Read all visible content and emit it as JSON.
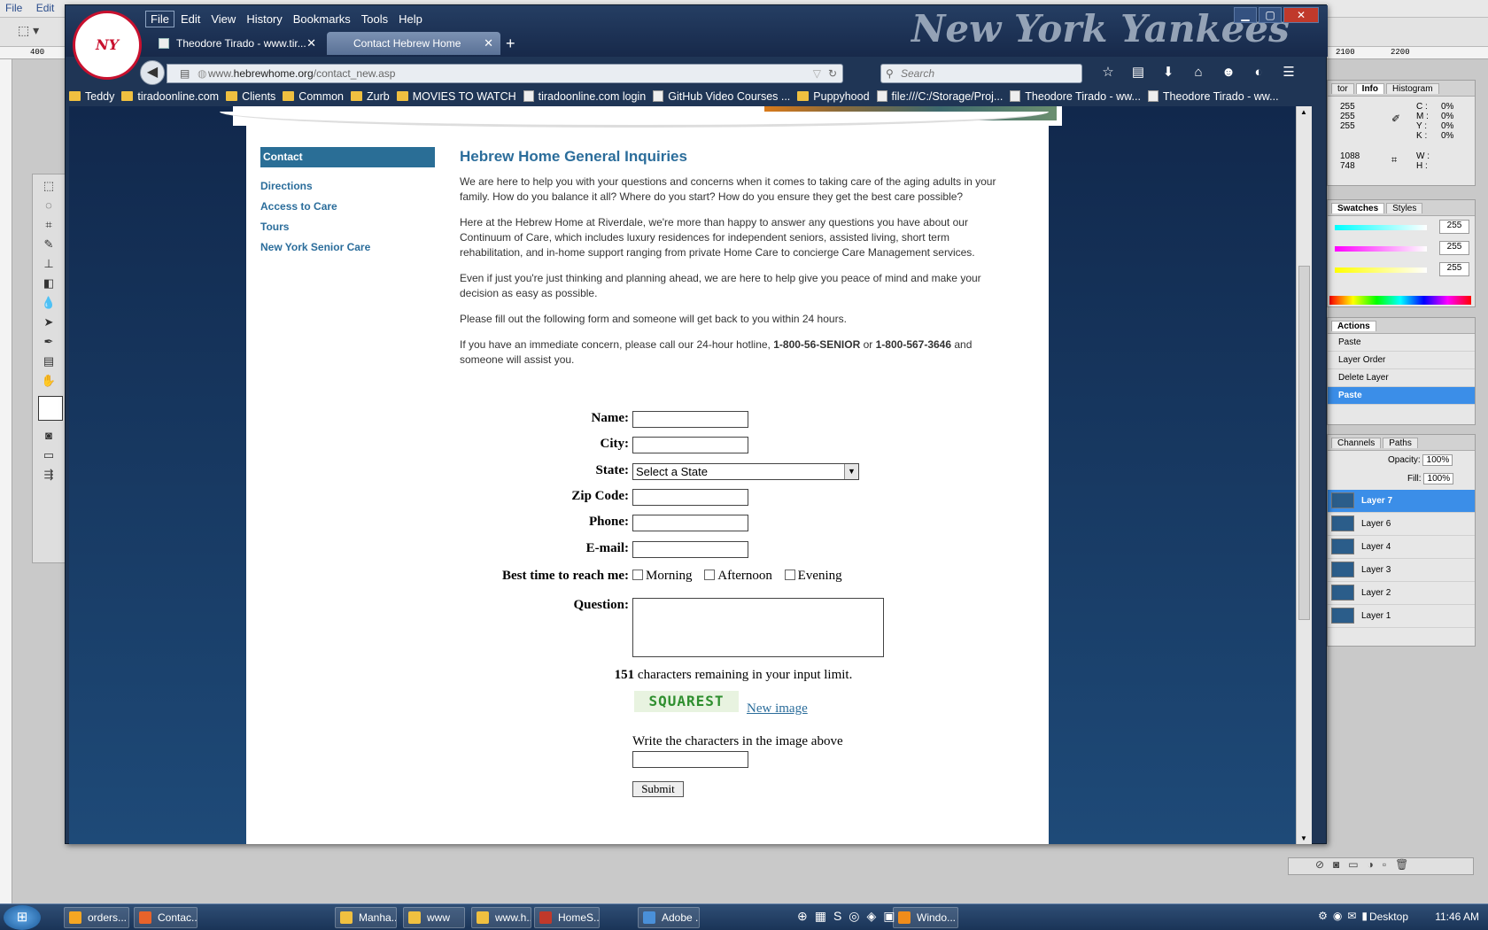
{
  "photoshop": {
    "menu": [
      "File",
      "Edit"
    ],
    "ruler_ticks": [
      "400",
      "2100",
      "2200"
    ],
    "info_tab_labels": [
      "tor",
      "Info",
      "Histogram"
    ],
    "info_values": [
      "255",
      "255",
      "255"
    ],
    "cmyk": [
      "C :",
      "M :",
      "Y :",
      "K :"
    ],
    "cmyk_values": [
      "0%",
      "0%",
      "0%",
      "0%"
    ],
    "xy": [
      "1088",
      "748"
    ],
    "wh": [
      "W :",
      "H :"
    ],
    "swatch_tabs": [
      "Swatches",
      "Styles"
    ],
    "rgb_values": [
      "255",
      "255",
      "255"
    ],
    "actions_tab": "Actions",
    "actions": [
      "Paste",
      "Layer Order",
      "Delete Layer",
      "Paste"
    ],
    "layers_tabs": [
      "Channels",
      "Paths"
    ],
    "opacity_label": "Opacity:",
    "opacity": "100%",
    "fill_label": "Fill:",
    "fill": "100%",
    "layers": [
      "Layer 7",
      "Layer 6",
      "Layer 4",
      "Layer 3",
      "Layer 2",
      "Layer 1"
    ]
  },
  "browser": {
    "menu": [
      "File",
      "Edit",
      "View",
      "History",
      "Bookmarks",
      "Tools",
      "Help"
    ],
    "brand_text": "New York Yankees",
    "tabs": [
      {
        "label": "Theodore Tirado - www.tir..."
      },
      {
        "label": "Contact Hebrew Home"
      }
    ],
    "url_prefix": "www.",
    "url_domain": "hebrewhome.org",
    "url_path": "/contact_new.asp",
    "search_placeholder": "Search",
    "bookmarks": [
      {
        "label": "Teddy",
        "type": "folder"
      },
      {
        "label": "tiradoonline.com",
        "type": "folder"
      },
      {
        "label": "Clients",
        "type": "folder"
      },
      {
        "label": "Common",
        "type": "folder"
      },
      {
        "label": "Zurb",
        "type": "folder"
      },
      {
        "label": "MOVIES TO WATCH",
        "type": "folder"
      },
      {
        "label": "tiradoonline.com login",
        "type": "page"
      },
      {
        "label": "GitHub Video Courses ...",
        "type": "page"
      },
      {
        "label": "Puppyhood",
        "type": "folder"
      },
      {
        "label": "file:///C:/Storage/Proj...",
        "type": "page"
      },
      {
        "label": "Theodore Tirado - ww...",
        "type": "page"
      },
      {
        "label": "Theodore Tirado - ww...",
        "type": "page"
      }
    ]
  },
  "page": {
    "sidenav_title": "Contact",
    "sidenav_links": [
      "Directions",
      "Access to Care",
      "Tours",
      "New York Senior Care"
    ],
    "heading": "Hebrew Home General Inquiries",
    "para1": "We are here to help you with your questions and concerns when it comes to taking care of the aging adults in your family. How do you balance it all? Where do you start? How do you ensure they get the best care possible?",
    "para2": "Here at the Hebrew Home at Riverdale, we're more than happy to answer any questions you have about our Continuum of Care, which includes luxury residences for independent seniors, assisted living, short term rehabilitation, and in-home support ranging from private Home Care to concierge Care Management services.",
    "para3": "Even if just you're just thinking and planning ahead, we are here to help give you peace of mind and make your decision as easy as possible.",
    "para4": "Please fill out the following form and someone will get back to you within 24 hours.",
    "para5_start": "If you have an immediate concern, please call our 24-hour hotline,",
    "hotline1": "1-800-56-SENIOR",
    "para5_or": "or",
    "hotline2": "1-800-567-3646",
    "para5_end": "and someone will assist you.",
    "form": {
      "name_label": "Name:",
      "city_label": "City:",
      "state_label": "State:",
      "state_value": "Select a State",
      "zip_label": "Zip Code:",
      "phone_label": "Phone:",
      "email_label": "E-mail:",
      "besttime_label": "Best time to reach me:",
      "time_options": [
        "Morning",
        "Afternoon",
        "Evening"
      ],
      "question_label": "Question:",
      "remaining_count": "151",
      "remaining_text": "characters remaining in your input limit.",
      "captcha_text": "SQUAREST",
      "new_image_link": "New image",
      "captcha_instruction": "Write the characters in the image above",
      "submit_label": "Submit"
    }
  },
  "taskbar": {
    "items": [
      {
        "label": "orders...",
        "color": "#f5a623"
      },
      {
        "label": "Contac...",
        "color": "#e8632a"
      },
      {
        "label": "Manha...",
        "color": "#f0c040"
      },
      {
        "label": "www",
        "color": "#f0c040"
      },
      {
        "label": "www.h...",
        "color": "#f0c040"
      },
      {
        "label": "HomeS...",
        "color": "#c0392b"
      },
      {
        "label": "Adobe ...",
        "color": "#4a90d9"
      },
      {
        "label": "Windo...",
        "color": "#f08c1a"
      }
    ],
    "desktop_label": "Desktop",
    "clock": "11:46 AM"
  }
}
